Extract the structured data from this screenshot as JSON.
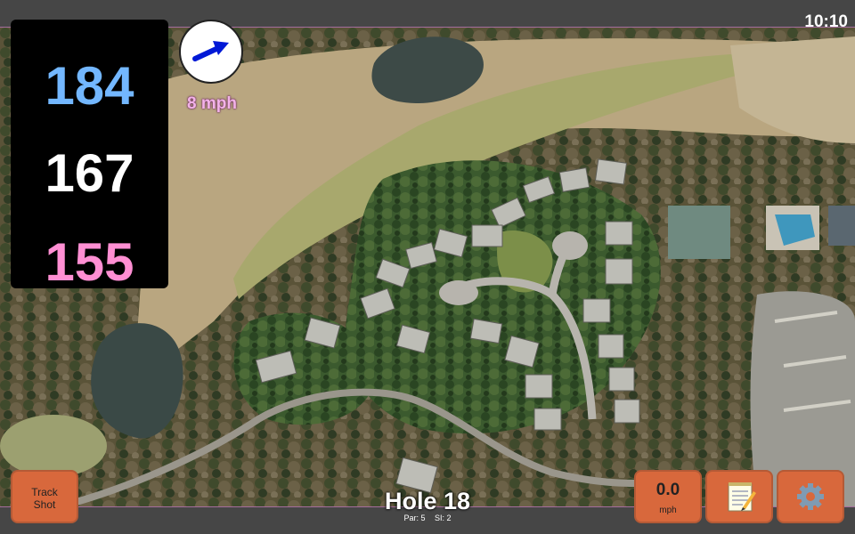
{
  "status_bar": {
    "time": "10:10"
  },
  "distances": {
    "back": "184",
    "middle": "167",
    "front": "155"
  },
  "wind": {
    "speed": "8 mph",
    "icon": "wind-direction-arrow-icon"
  },
  "buttons": {
    "track_shot_line1": "Track",
    "track_shot_line2": "Shot",
    "speed_value": "0.0",
    "speed_unit": "mph",
    "notes_icon": "notepad-icon",
    "settings_icon": "gear-icon"
  },
  "hole": {
    "title": "Hole 18",
    "par_label": "Par: 5",
    "si_label": "SI: 2"
  },
  "colors": {
    "back": "#73b7ff",
    "middle": "#ffffff",
    "front": "#ff8fd3",
    "button": "#d8683c"
  }
}
